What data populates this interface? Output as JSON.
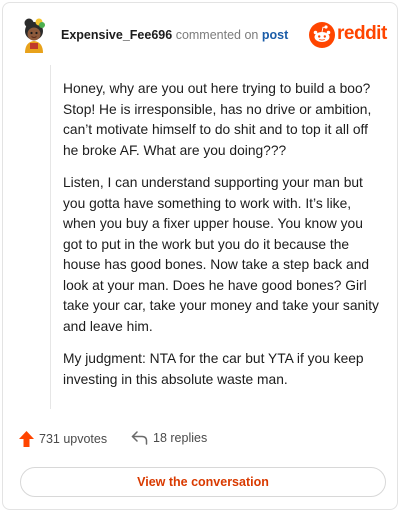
{
  "header": {
    "username": "Expensive_Fee696",
    "commented_text": "commented on",
    "post_link": "post",
    "brand": "reddit"
  },
  "comment": {
    "paragraphs": [
      "Honey, why are you out here trying to build a boo? Stop! He is irresponsible, has no drive or ambition, can’t motivate himself to do shit and to top it all off he broke AF. What are you doing???",
      "Listen, I can understand supporting your man but you gotta have something to work with. It’s like, when you buy a fixer upper house. You know you got to put in the work but you do it because the house has good bones. Now take a step back and look at your man. Does he have good bones? Girl take your car, take your money and take your sanity and leave him.",
      "My judgment: NTA for the car but YTA if you keep investing in this absolute waste man."
    ]
  },
  "actions": {
    "upvotes": "731 upvotes",
    "replies": "18 replies"
  },
  "footer": {
    "view_button": "View the conversation"
  },
  "icons": {
    "upvote": "upvote-arrow-icon",
    "reply": "reply-arrow-icon",
    "logo": "reddit-snoo-icon"
  },
  "colors": {
    "brand": "#ff4500",
    "link": "#1a5ca8",
    "button_text": "#d93a00"
  }
}
